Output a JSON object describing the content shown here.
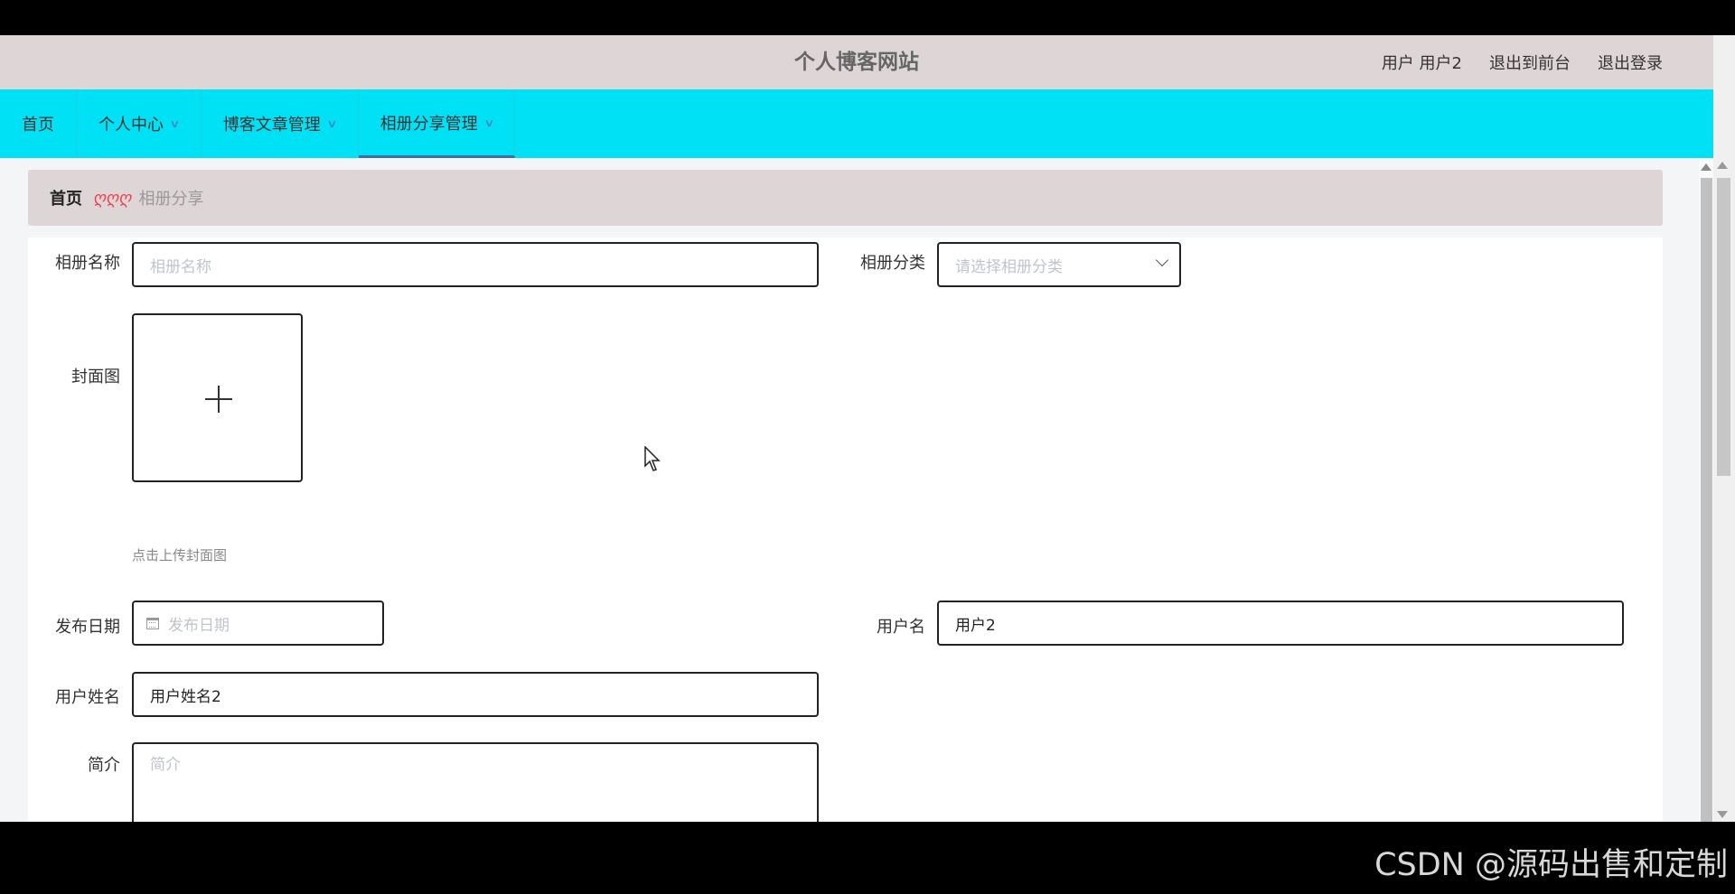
{
  "header": {
    "site_title": "个人博客网站",
    "user_label": "用户 用户2",
    "front_link": "退出到前台",
    "logout_link": "退出登录"
  },
  "nav": {
    "items": [
      {
        "label": "首页",
        "has_dropdown": false,
        "active": false
      },
      {
        "label": "个人中心",
        "has_dropdown": true,
        "active": false
      },
      {
        "label": "博客文章管理",
        "has_dropdown": true,
        "active": false
      },
      {
        "label": "相册分享管理",
        "has_dropdown": true,
        "active": true
      }
    ]
  },
  "breadcrumb": {
    "home": "首页",
    "separator": "ღღღ",
    "current": "相册分享"
  },
  "form": {
    "album_name": {
      "label": "相册名称",
      "placeholder": "相册名称",
      "value": ""
    },
    "album_category": {
      "label": "相册分类",
      "placeholder": "请选择相册分类",
      "value": ""
    },
    "cover": {
      "label": "封面图",
      "hint": "点击上传封面图"
    },
    "publish_date": {
      "label": "发布日期",
      "placeholder": "发布日期",
      "value": ""
    },
    "username": {
      "label": "用户名",
      "value": "用户2"
    },
    "user_realname": {
      "label": "用户姓名",
      "value": "用户姓名2"
    },
    "intro": {
      "label": "简介",
      "placeholder": "简介",
      "value": ""
    }
  },
  "watermark": "CSDN @源码出售和定制",
  "colors": {
    "header_bg": "#ded6d6",
    "nav_bg": "#00e1f5",
    "breadcrumb_separator": "#ef4050",
    "active_tab_border": "#3a6fb0"
  }
}
